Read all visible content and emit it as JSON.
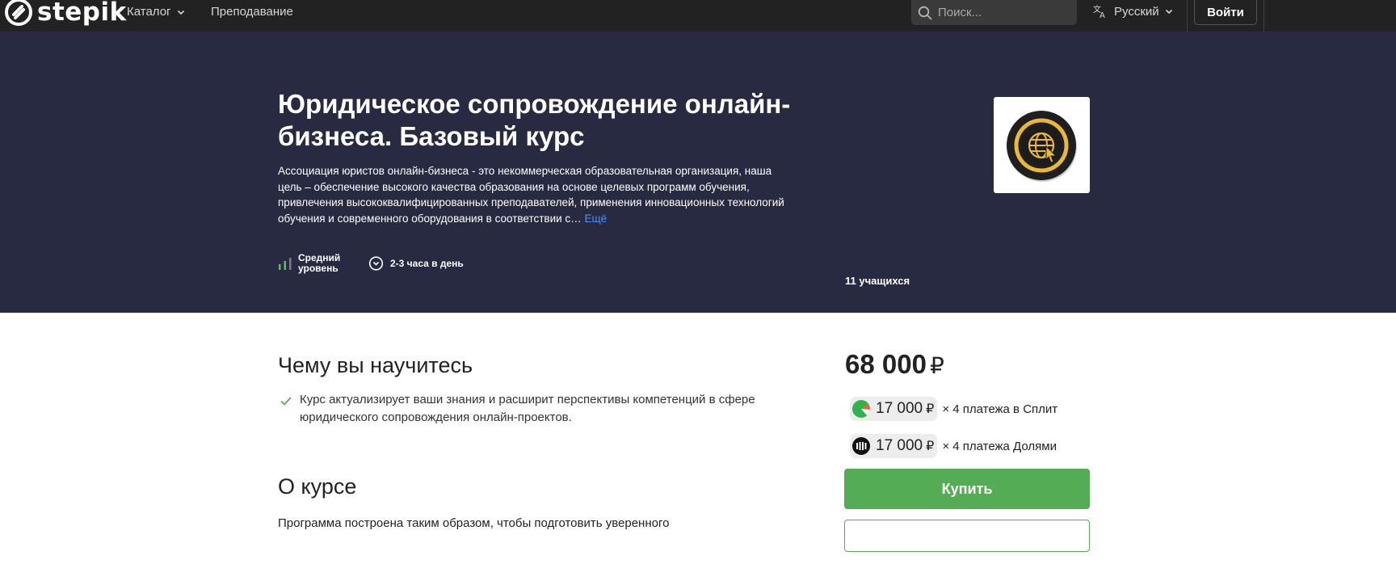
{
  "header": {
    "logo_text": "stepik",
    "nav": [
      {
        "label": "Каталог",
        "has_dropdown": true
      },
      {
        "label": "Преподавание",
        "has_dropdown": false
      }
    ],
    "search_placeholder": "Поиск...",
    "language": "Русский",
    "login_label": "Войти"
  },
  "hero": {
    "title": "Юридическое сопровождение онлайн-бизнеса. Базовый курс",
    "summary": "Ассоциация юристов онлайн-бизнеса - это некоммерческая образовательная организация, наша цель – обеспечение высокого качества образования на основе целевых программ обучения, привлечения высококвалифицированных преподавателей, применения инновационных технологий обучения и современного оборудования в соответствии с…",
    "more_link": "Ещё",
    "level_line1": "Средний",
    "level_line2": "уровень",
    "workload": "2-3 часа в день",
    "learners": "11 учащихся",
    "cover_icon": "globe-cursor-icon"
  },
  "main": {
    "learn_heading": "Чему вы научитесь",
    "outcomes": [
      "Курс актуализирует ваши знания и расширит перспективы компетенций в сфере юридического сопровождения онлайн-проектов."
    ],
    "about_heading": "О курсе",
    "about_text": "Программа построена таким образом, чтобы подготовить уверенного"
  },
  "purchase": {
    "price": "68 000",
    "currency": "₽",
    "plans": [
      {
        "amount": "17 000",
        "currency": "₽",
        "label": "× 4 платежа в Сплит",
        "icon": "split-icon"
      },
      {
        "amount": "17 000",
        "currency": "₽",
        "label": "× 4 платежа Долями",
        "icon": "dolyami-icon"
      }
    ],
    "buy_label": "Купить"
  },
  "colors": {
    "topbar": "#222222",
    "hero_bg": "#272a41",
    "accent_green": "#54ad54",
    "link_blue": "#4e8eff"
  }
}
